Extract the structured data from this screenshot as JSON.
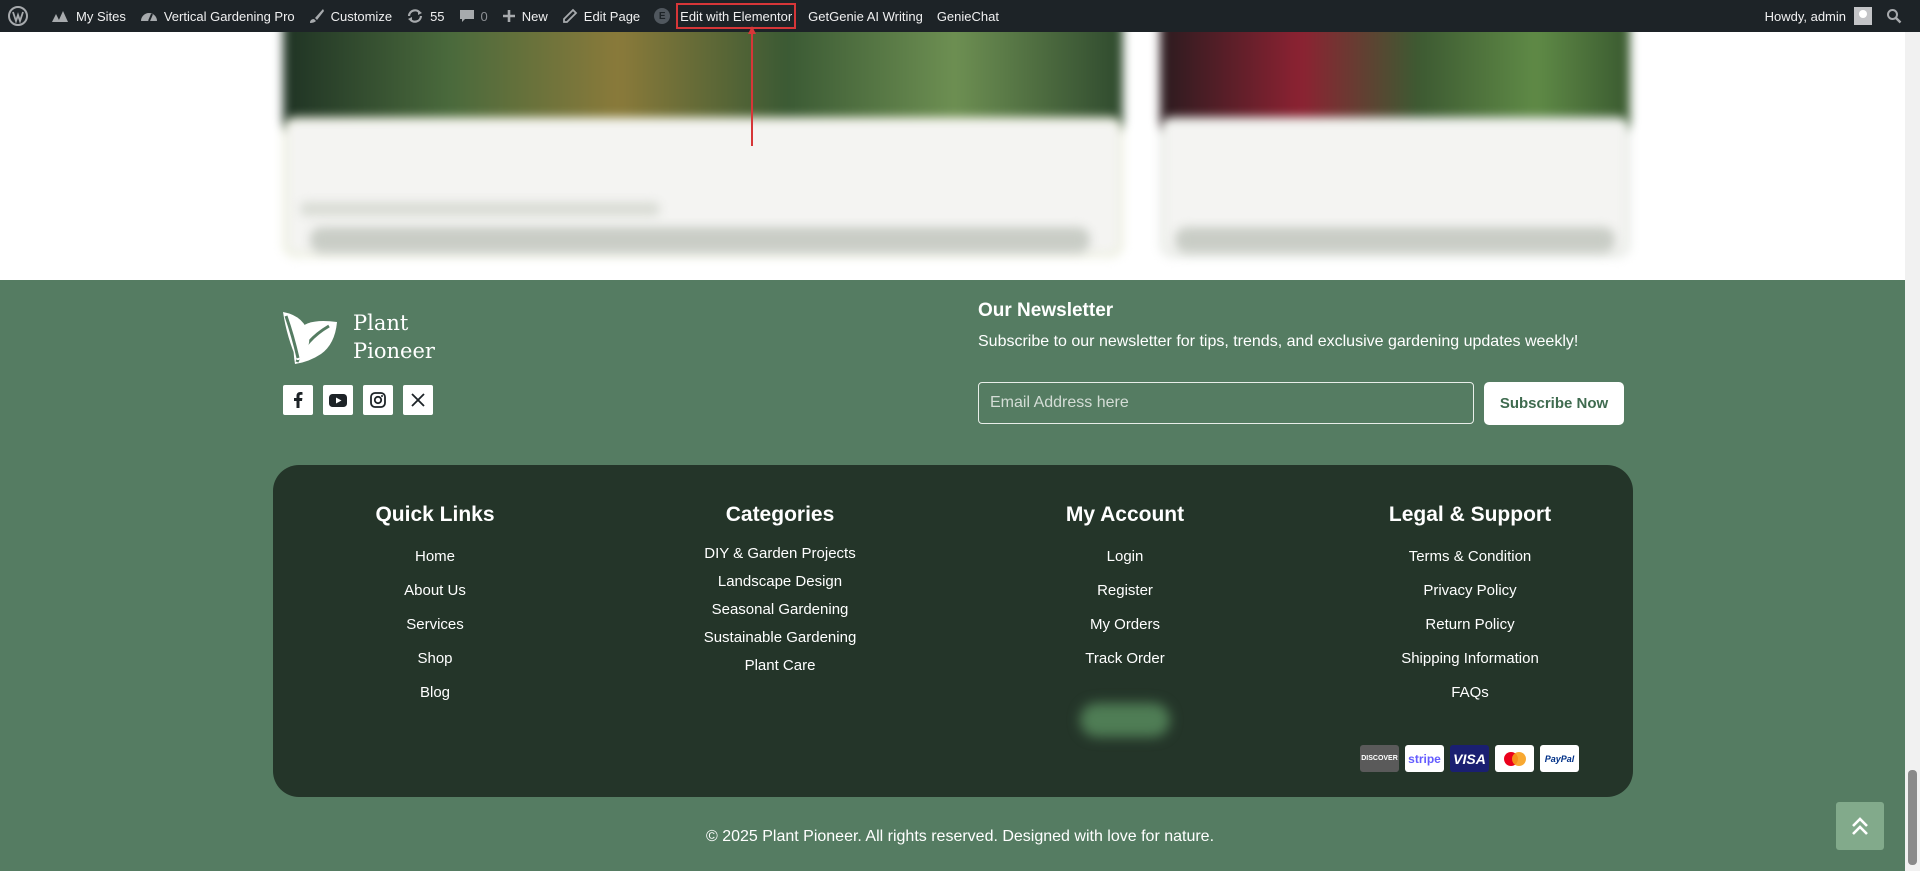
{
  "admin_bar": {
    "my_sites": "My Sites",
    "site_name": "Vertical Gardening Pro",
    "customize": "Customize",
    "updates_count": "55",
    "comments_count": "0",
    "new": "New",
    "edit_page": "Edit Page",
    "edit_elementor": "Edit with Elementor",
    "elementor_badge": "E",
    "getgenie": "GetGenie AI Writing",
    "geniechat": "GenieChat",
    "howdy": "Howdy, admin",
    "icons": [
      "wordpress-icon",
      "my-sites-icon",
      "dashboard-icon",
      "brush-icon",
      "updates-icon",
      "comment-icon",
      "plus-icon",
      "pencil-icon",
      "elementor-icon",
      "search-icon"
    ]
  },
  "annotation": {
    "color": "#d63638"
  },
  "footer": {
    "brand": {
      "line1": "Plant",
      "line2": "Pioneer"
    },
    "socials": [
      "facebook-icon",
      "youtube-icon",
      "instagram-icon",
      "x-icon"
    ],
    "newsletter": {
      "title": "Our Newsletter",
      "text": "Subscribe to our newsletter for tips, trends, and exclusive gardening updates weekly!",
      "placeholder": "Email Address here",
      "button": "Subscribe Now"
    },
    "columns": [
      {
        "title": "Quick Links",
        "links": [
          "Home",
          "About Us",
          "Services",
          "Shop",
          "Blog"
        ]
      },
      {
        "title": "Categories",
        "links": [
          "DIY & Garden Projects",
          "Landscape Design",
          "Seasonal Gardening",
          "Sustainable Gardening",
          "Plant Care"
        ]
      },
      {
        "title": "My Account",
        "links": [
          "Login",
          "Register",
          "My Orders",
          "Track Order"
        ]
      },
      {
        "title": "Legal & Support",
        "links": [
          "Terms & Condition",
          "Privacy Policy",
          "Return Policy",
          "Shipping Information",
          "FAQs"
        ]
      }
    ],
    "payments": [
      {
        "label": "DISCOVER",
        "bg": "#5a5a5a",
        "color": "#ffffff"
      },
      {
        "label": "stripe",
        "bg": "#ffffff",
        "color": "#635bff"
      },
      {
        "label": "VISA",
        "bg": "#1a1f71",
        "color": "#ffffff"
      },
      {
        "label": "",
        "bg": "#ffffff",
        "color": "#eb001b"
      },
      {
        "label": "PayPal",
        "bg": "#ffffff",
        "color": "#003087"
      }
    ],
    "copyright": "© 2025 Plant Pioneer. All rights reserved. Designed with love for nature."
  },
  "colors": {
    "admin_bar_bg": "#1d2327",
    "footer_bg": "#557c62",
    "panel_bg": "#243529",
    "scroll_top_bg": "#82aa8b"
  }
}
